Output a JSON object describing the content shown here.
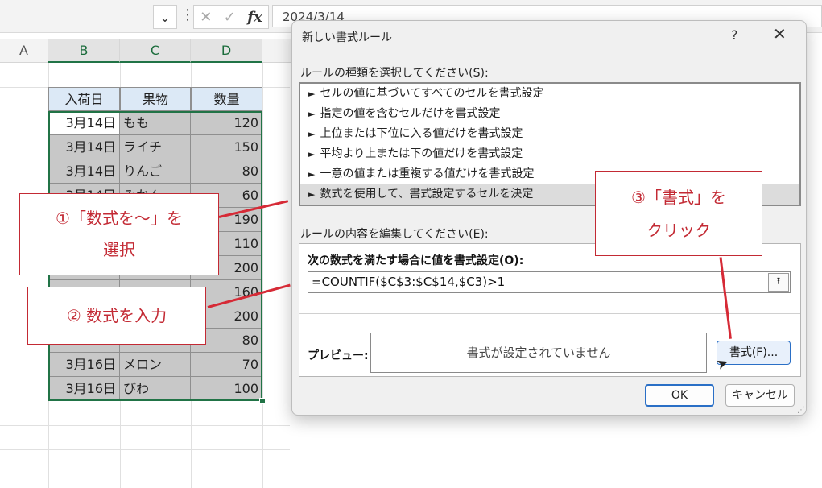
{
  "formula_bar": {
    "namebox_arrow": "⌄",
    "dots": "⋮",
    "cancel": "✕",
    "enter": "✓",
    "fx": "fx",
    "value": "2024/3/14"
  },
  "sheet": {
    "columns": [
      "A",
      "B",
      "C",
      "D"
    ],
    "headers": [
      "入荷日",
      "果物",
      "数量"
    ],
    "rows": [
      {
        "date": "3月14日",
        "fruit": "もも",
        "qty": "120"
      },
      {
        "date": "3月14日",
        "fruit": "ライチ",
        "qty": "150"
      },
      {
        "date": "3月14日",
        "fruit": "りんご",
        "qty": "80"
      },
      {
        "date": "3月14日",
        "fruit": "みかん",
        "qty": "60"
      },
      {
        "date": "",
        "fruit": "",
        "qty": "190"
      },
      {
        "date": "",
        "fruit": "",
        "qty": "110"
      },
      {
        "date": "",
        "fruit": "",
        "qty": "200"
      },
      {
        "date": "",
        "fruit": "",
        "qty": "160"
      },
      {
        "date": "",
        "fruit": "",
        "qty": "200"
      },
      {
        "date": "",
        "fruit": "",
        "qty": "80"
      },
      {
        "date": "3月16日",
        "fruit": "メロン",
        "qty": "70"
      },
      {
        "date": "3月16日",
        "fruit": "びわ",
        "qty": "100"
      }
    ]
  },
  "dialog": {
    "title": "新しい書式ルール",
    "help": "?",
    "close": "✕",
    "rule_type_label": "ルールの種類を選択してください(S):",
    "rule_types": [
      "セルの値に基づいてすべてのセルを書式設定",
      "指定の値を含むセルだけを書式設定",
      "上位または下位に入る値だけを書式設定",
      "平均より上または下の値だけを書式設定",
      "一意の値または重複する値だけを書式設定",
      "数式を使用して、書式設定するセルを決定"
    ],
    "rule_arrow": "►",
    "edit_label": "ルールの内容を編集してください(E):",
    "formula_title": "次の数式を満たす場合に値を書式設定(O):",
    "formula_value": "=COUNTIF($C$3:$C$14,$C3)>1",
    "collapse_icon": "⭱",
    "preview_label": "プレビュー:",
    "preview_text": "書式が設定されていません",
    "format_button": "書式(F)...",
    "ok_button": "OK",
    "cancel_button": "キャンセル"
  },
  "callouts": {
    "c1_line1": "①「数式を〜」を",
    "c1_line2": "選択",
    "c2": "② 数式を入力",
    "c3_line1": "③「書式」を",
    "c3_line2": "クリック"
  },
  "colors": {
    "callout_red": "#c32a34",
    "selection_green": "#217346",
    "header_blue": "#dce9f6",
    "dup_gray": "#c8c8c8"
  }
}
